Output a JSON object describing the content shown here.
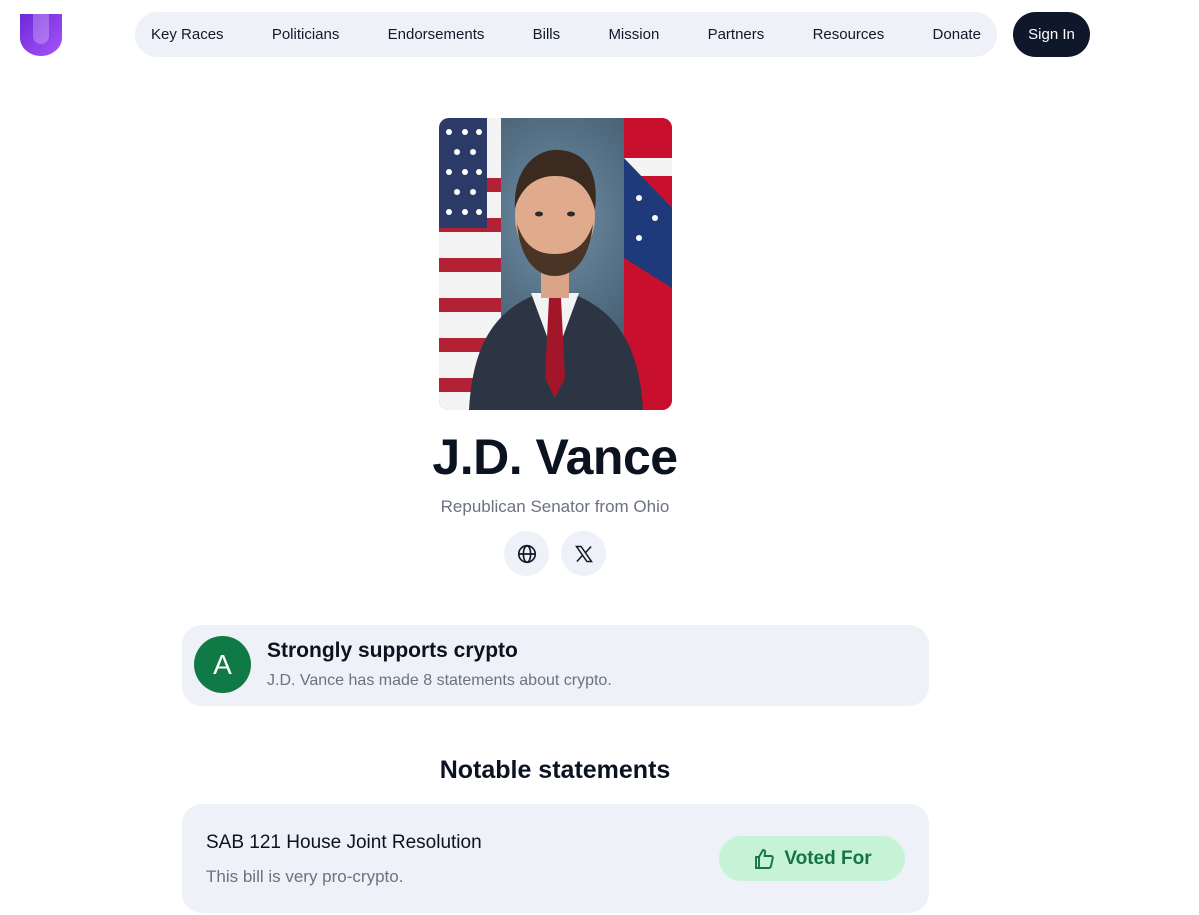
{
  "nav": {
    "items": [
      "Key Races",
      "Politicians",
      "Endorsements",
      "Bills",
      "Mission",
      "Partners",
      "Resources",
      "Donate"
    ],
    "sign_in": "Sign In"
  },
  "brand": {
    "logo_icon": "shield-logo-icon",
    "accent": "#7c3aed"
  },
  "profile": {
    "name": "J.D. Vance",
    "subtitle": "Republican Senator from Ohio",
    "links": [
      {
        "icon": "globe-icon"
      },
      {
        "icon": "x-logo-icon"
      }
    ]
  },
  "grade": {
    "letter": "A",
    "title": "Strongly supports crypto",
    "description": "J.D. Vance has made 8 statements about crypto.",
    "color": "#0f7a46"
  },
  "statements_section": {
    "title": "Notable statements",
    "items": [
      {
        "title": "SAB 121 House Joint Resolution",
        "description": "This bill is very pro-crypto.",
        "vote_label": "Voted For",
        "vote_icon": "thumbs-up-icon",
        "vote_color": "#157347"
      }
    ]
  }
}
